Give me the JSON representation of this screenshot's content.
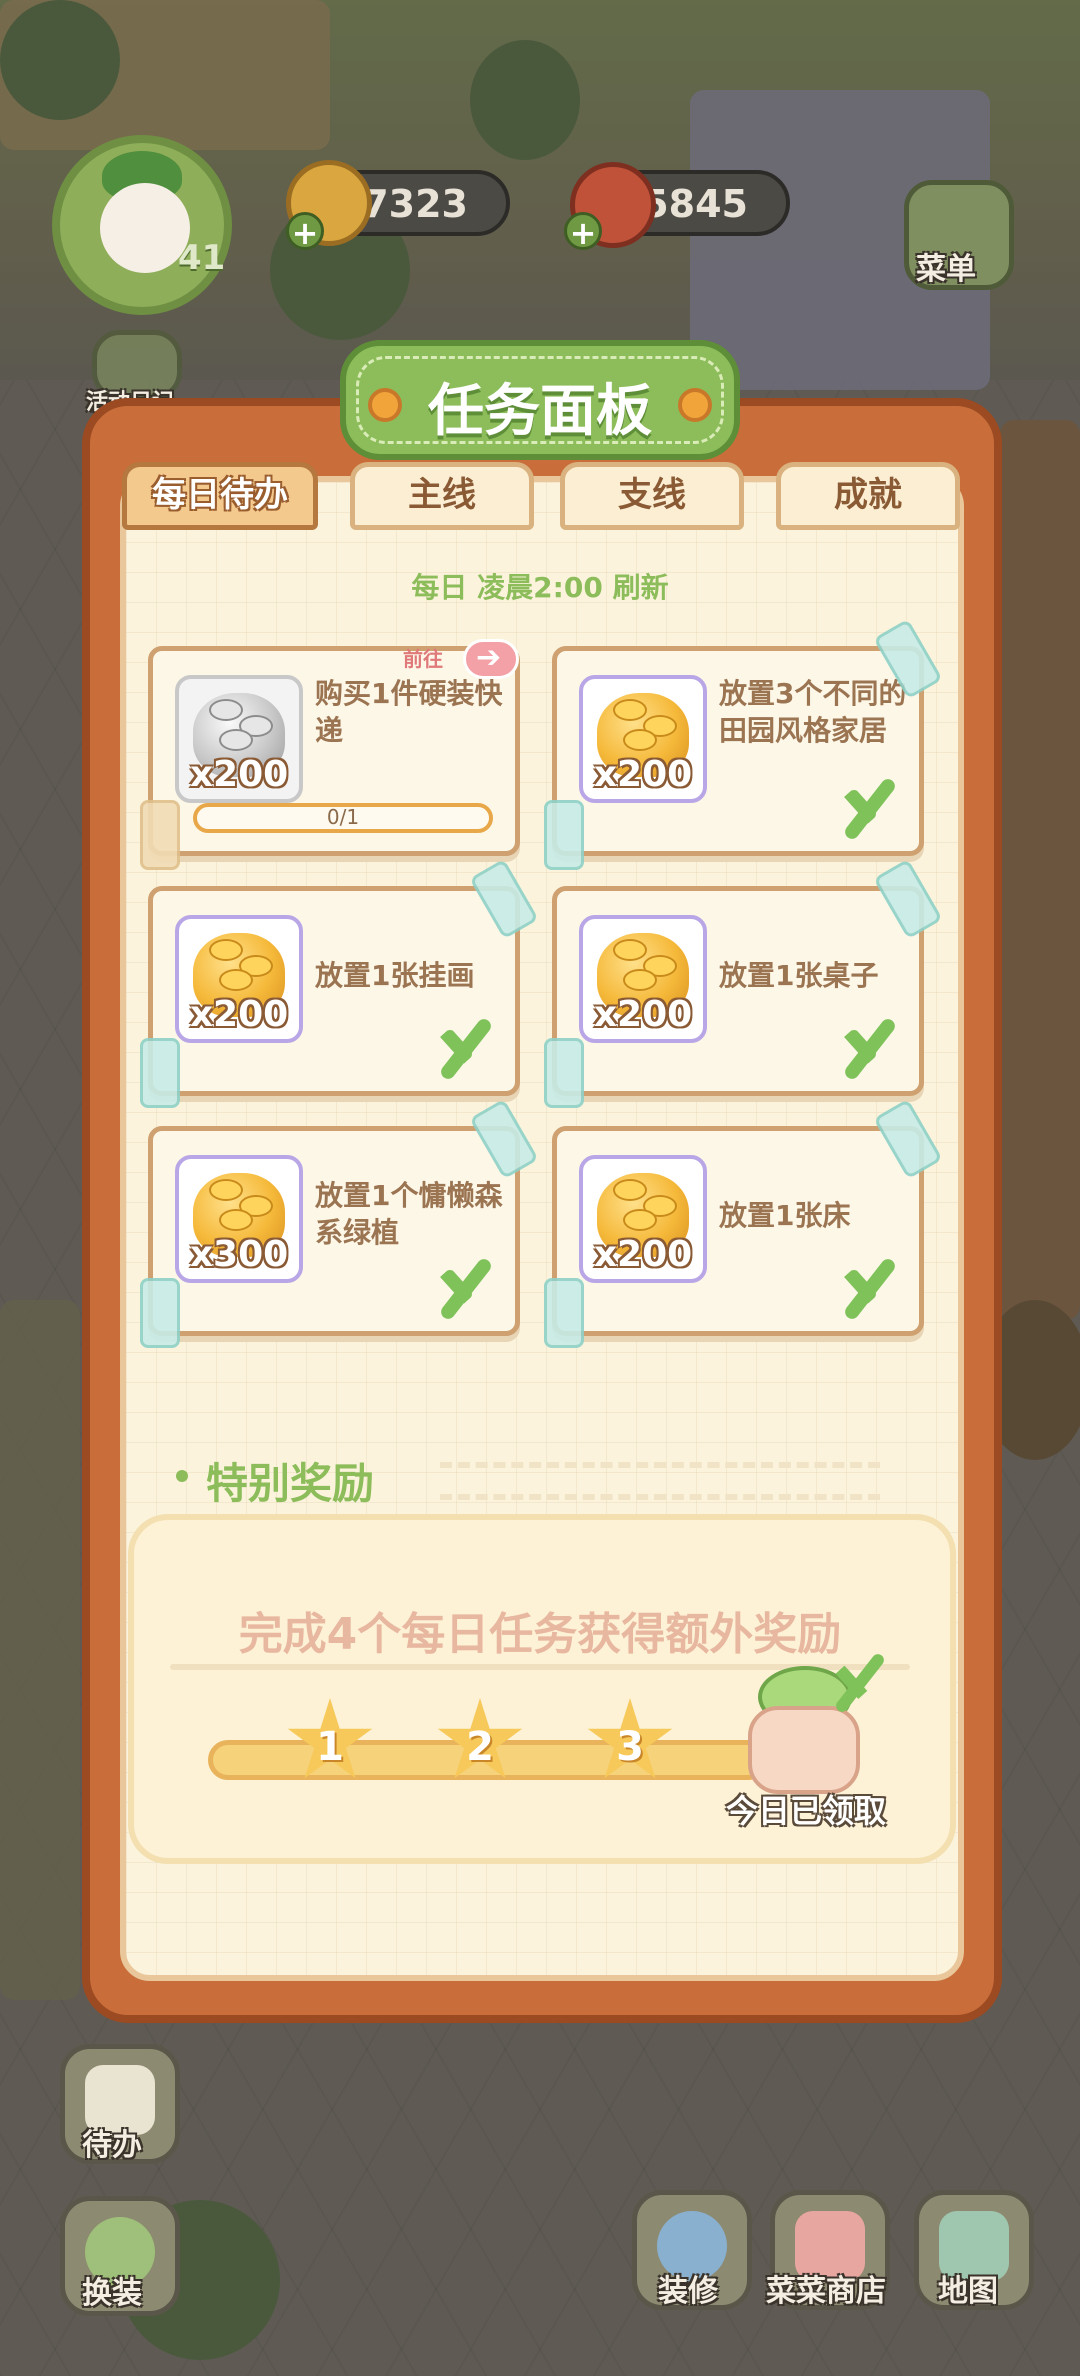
{
  "hud": {
    "player_level": "41",
    "coins": "7323",
    "hearts": "5845",
    "menu_label": "菜单",
    "activity_label": "活动日记",
    "todo_label": "待办",
    "dress_label": "换装",
    "decorate_label": "装修",
    "shop_label": "菜菜商店",
    "map_label": "地图"
  },
  "panel": {
    "title": "任务面板",
    "tabs": [
      "每日待办",
      "主线",
      "支线",
      "成就"
    ],
    "active_tab": "每日待办",
    "refresh_text": "每日 凌晨2:00 刷新"
  },
  "tasks": [
    {
      "text": "购买1件硬装快递",
      "reward": "x200",
      "coin_type": "silver",
      "progress": "0/1",
      "go_label": "前往",
      "done": false
    },
    {
      "text": "放置3个不同的田园风格家居",
      "reward": "x200",
      "coin_type": "gold",
      "done": true
    },
    {
      "text": "放置1张挂画",
      "reward": "x200",
      "coin_type": "gold",
      "done": true
    },
    {
      "text": "放置1张桌子",
      "reward": "x200",
      "coin_type": "gold",
      "done": true
    },
    {
      "text": "放置1个慵懒森系绿植",
      "reward": "x300",
      "coin_type": "gold",
      "done": true
    },
    {
      "text": "放置1张床",
      "reward": "x200",
      "coin_type": "gold",
      "done": true
    }
  ],
  "special": {
    "title": "特别奖励",
    "description": "完成4个每日任务获得额外奖励",
    "milestones": [
      "1",
      "2",
      "3"
    ],
    "claimed_label": "今日已领取"
  },
  "colors": {
    "panel_frame": "#c96d3a",
    "title_green": "#8cbd5a",
    "check_green": "#7fc25a",
    "paper": "#fbf3dc"
  }
}
